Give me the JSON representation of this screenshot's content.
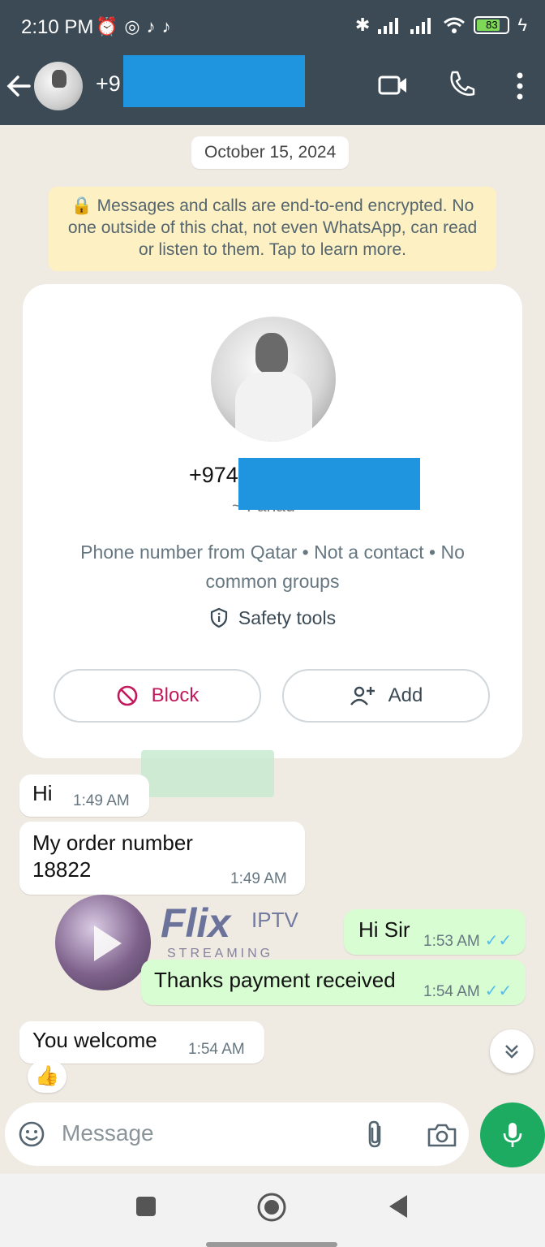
{
  "status_bar": {
    "time": "2:10 PM",
    "left_icons": [
      "alarm-icon",
      "instagram-icon",
      "tiktok-icon",
      "tiktok-icon"
    ],
    "right_icons": [
      "bluetooth-icon",
      "signal-icon",
      "signal-icon",
      "wifi-icon"
    ],
    "battery": "83"
  },
  "header": {
    "contact": "+9",
    "actions": [
      "video-call-icon",
      "phone-icon",
      "more-icon"
    ]
  },
  "chat": {
    "date_chip": "October 15, 2024",
    "encryption_notice": "🔒 Messages and calls are end-to-end encrypted. No one outside of this chat, not even WhatsApp, can read or listen to them. Tap to learn more.",
    "contact_card": {
      "number": "+974",
      "sub_name": "~ Fahad",
      "info": "Phone number from Qatar • Not a contact • No common groups",
      "safety_tools": "Safety tools",
      "block_label": "Block",
      "add_label": "Add"
    },
    "messages": [
      {
        "direction": "in",
        "text": "Hi",
        "time": "1:49 AM"
      },
      {
        "direction": "in",
        "text": "My order number\n18822",
        "time": "1:49 AM"
      },
      {
        "direction": "out",
        "text": "Hi Sir",
        "time": "1:53 AM",
        "status": "read"
      },
      {
        "direction": "out",
        "text": "Thanks payment received",
        "time": "1:54 AM",
        "status": "read"
      },
      {
        "direction": "in",
        "text": "You welcome",
        "time": "1:54 AM",
        "reaction": "👍"
      }
    ],
    "watermark": {
      "brand": "Flix",
      "tag": "IPTV",
      "sub": "STREAMING",
      "bg_brand": "dish"
    }
  },
  "composer": {
    "placeholder": "Message"
  },
  "colors": {
    "header": "#3b4a54",
    "wallpaper": "#efeae2",
    "outgoing": "#d9fdd3",
    "accent": "#1daa61",
    "block": "#c2185b",
    "redaction": "#1f95df"
  }
}
